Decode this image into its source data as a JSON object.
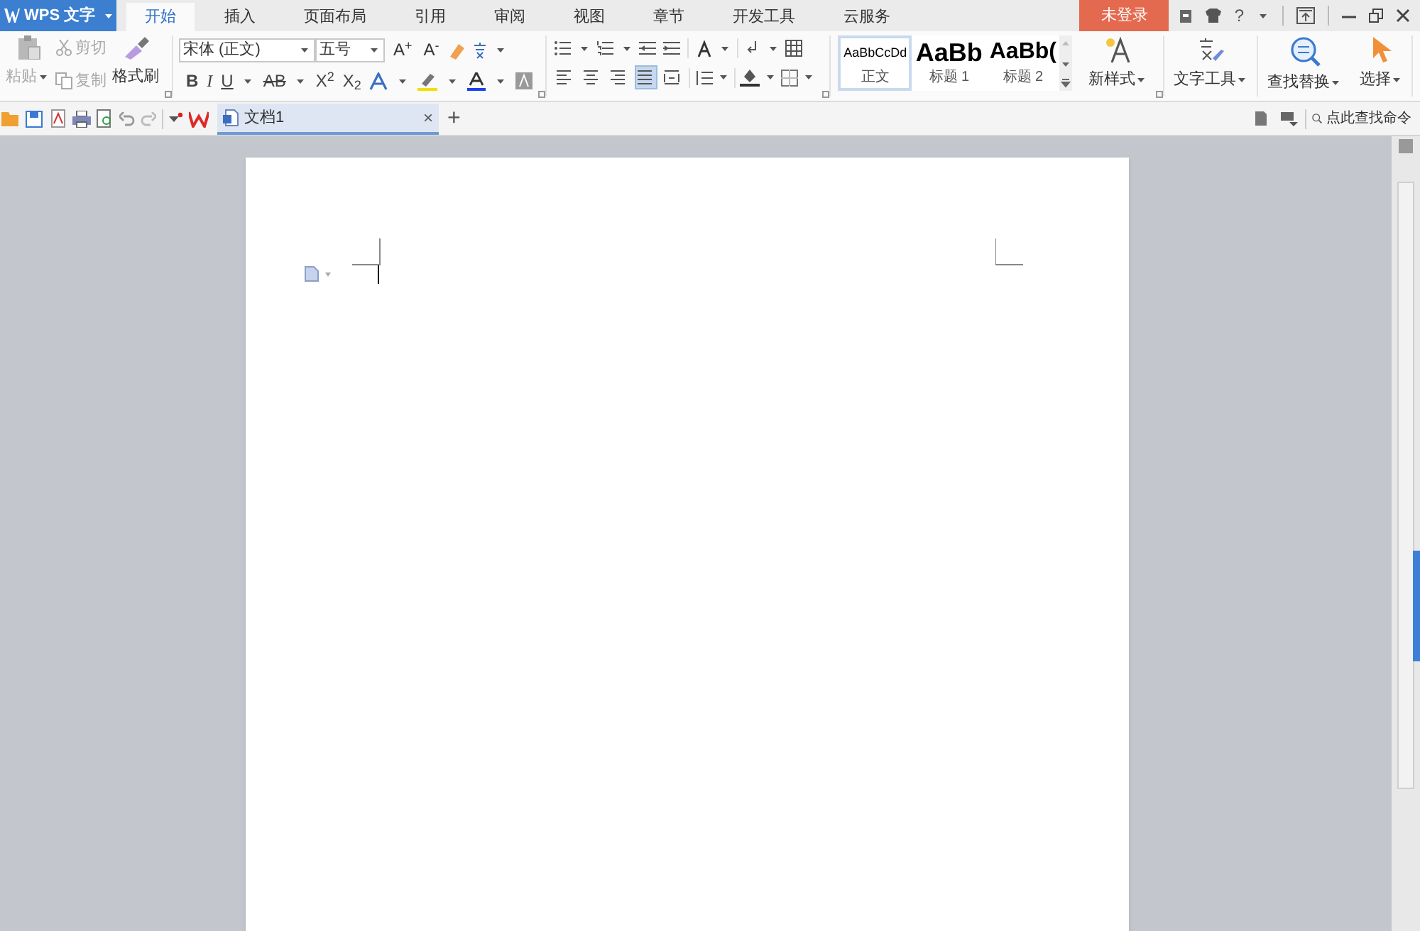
{
  "app": {
    "name": "WPS 文字"
  },
  "tabs": [
    {
      "label": "开始",
      "selected": true
    },
    {
      "label": "插入",
      "selected": false
    },
    {
      "label": "页面布局",
      "selected": false
    },
    {
      "label": "引用",
      "selected": false
    },
    {
      "label": "审阅",
      "selected": false
    },
    {
      "label": "视图",
      "selected": false
    },
    {
      "label": "章节",
      "selected": false
    },
    {
      "label": "开发工具",
      "selected": false
    },
    {
      "label": "云服务",
      "selected": false
    }
  ],
  "login": "未登录",
  "help": "?",
  "clipboard": {
    "paste": {
      "label": "粘贴",
      "disabled": true
    },
    "cut": {
      "label": "剪切",
      "disabled": true
    },
    "copy": {
      "label": "复制",
      "disabled": true
    },
    "painter": {
      "label": "格式刷",
      "disabled": false
    }
  },
  "font": {
    "name": "宋体 (正文)",
    "size": "五号"
  },
  "size_buttons": [
    "A$^{+}$",
    "A$^{-}$"
  ],
  "format_buttons": [
    "B",
    "I",
    "U",
    "AB",
    "X$^{2}$",
    "X$_{2}$"
  ],
  "align_buttons": [
    {
      "selected": false
    },
    {
      "selected": false
    },
    {
      "selected": false
    },
    {
      "selected": true
    },
    {
      "selected": false
    }
  ],
  "styles": [
    {
      "sample": "AaBbCcDd",
      "label": "正文",
      "selected": true
    },
    {
      "sample": "AaBb",
      "label": "标题 1",
      "selected": false
    },
    {
      "sample": "AaBb(",
      "label": "标题 2",
      "selected": false
    }
  ],
  "big_buttons": [
    {
      "kind": "new-style",
      "label": "新样式"
    },
    {
      "kind": "text-tools",
      "label": "文字工具"
    },
    {
      "kind": "find-replace",
      "label": "查找替换"
    },
    {
      "kind": "select",
      "label": "选择"
    }
  ],
  "doc_tabs": [
    {
      "title": "文档1",
      "close": "×"
    }
  ],
  "add_tab": "+",
  "command_search": {
    "placeholder": "点此查找命令"
  }
}
